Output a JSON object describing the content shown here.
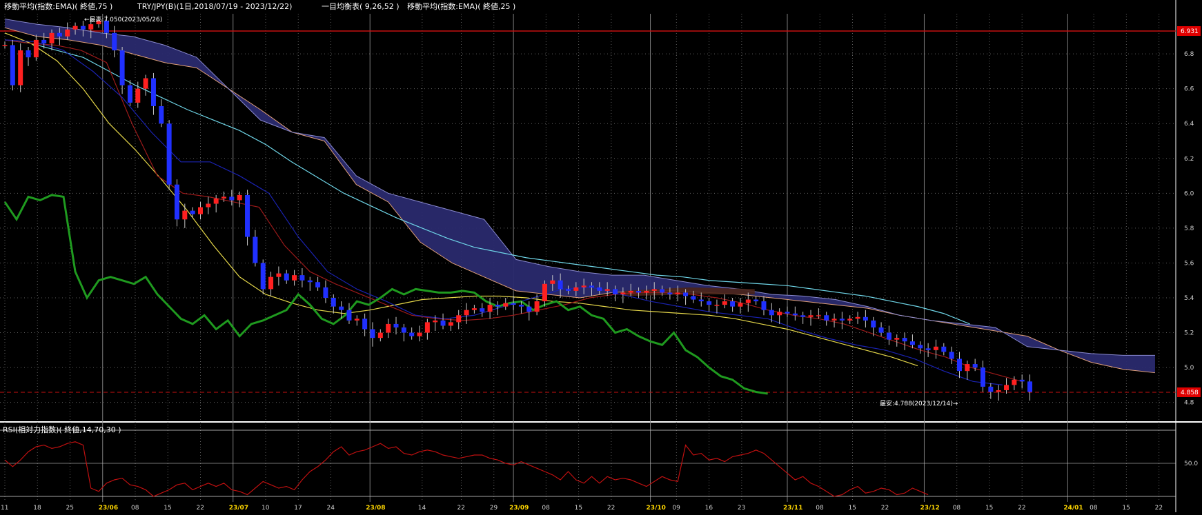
{
  "header": {
    "ema75_label": "移動平均(指数:EMA)( 終値,75 )",
    "symbol_label": "TRY/JPY(B)(1日,2018/07/19 - 2023/12/22)",
    "ichimoku_label": "一目均衡表( 9,26,52 )",
    "ema25_label": "移動平均(指数:EMA)( 終値,25 )"
  },
  "rsi_panel": {
    "title": "RSI(相対力指数)( 終値,14,70,30 )"
  },
  "annotations": {
    "high_label": "←最高:7.050(2023/05/26)",
    "low_label": "最安:4.788(2023/12/14)→"
  },
  "price_boxes": {
    "top_value": "6.931",
    "current_value": "4.858"
  },
  "colors": {
    "background": "#000000",
    "grid": "#ffffff",
    "candle_up": "#ff2020",
    "candle_down": "#2030ff",
    "cloud_fill": "#2a2a6e",
    "cloud_bear_fill": "#4a2418",
    "ema75": "#6fd6e8",
    "ema25": "#e6d84a",
    "kijun": "#9c1a1a",
    "tenkan": "#1a22b0",
    "chikou": "#1f9a1f",
    "span_b_line": "#e0a078",
    "span_a_line": "#8a8ad0",
    "rsi_line": "#c01010",
    "ref_line": "#c81010"
  },
  "chart_data": {
    "type": "candlestick",
    "symbol": "TRY/JPY",
    "ylim": [
      4.72,
      7.1
    ],
    "y_ticks": [
      "6.8",
      "6.6",
      "6.4",
      "6.2",
      "6.0",
      "5.8",
      "5.6",
      "5.4",
      "5.2",
      "5.0",
      "4.8"
    ],
    "x_ticks": [
      {
        "label": "11",
        "day": 0,
        "month": false
      },
      {
        "label": "18",
        "day": 5,
        "month": false
      },
      {
        "label": "25",
        "day": 10,
        "month": false
      },
      {
        "label": "23/06",
        "day": 15,
        "month": true
      },
      {
        "label": "08",
        "day": 20,
        "month": false
      },
      {
        "label": "15",
        "day": 25,
        "month": false
      },
      {
        "label": "22",
        "day": 30,
        "month": false
      },
      {
        "label": "23/07",
        "day": 35,
        "month": true
      },
      {
        "label": "10",
        "day": 40,
        "month": false
      },
      {
        "label": "17",
        "day": 45,
        "month": false
      },
      {
        "label": "24",
        "day": 50,
        "month": false
      },
      {
        "label": "23/08",
        "day": 56,
        "month": true
      },
      {
        "label": "14",
        "day": 64,
        "month": false
      },
      {
        "label": "22",
        "day": 70,
        "month": false
      },
      {
        "label": "29",
        "day": 75,
        "month": false
      },
      {
        "label": "23/09",
        "day": 78,
        "month": true
      },
      {
        "label": "08",
        "day": 83,
        "month": false
      },
      {
        "label": "15",
        "day": 88,
        "month": false
      },
      {
        "label": "22",
        "day": 93,
        "month": false
      },
      {
        "label": "23/10",
        "day": 99,
        "month": true
      },
      {
        "label": "09",
        "day": 103,
        "month": false
      },
      {
        "label": "16",
        "day": 108,
        "month": false
      },
      {
        "label": "23",
        "day": 113,
        "month": false
      },
      {
        "label": "23/11",
        "day": 120,
        "month": true
      },
      {
        "label": "08",
        "day": 125,
        "month": false
      },
      {
        "label": "15",
        "day": 130,
        "month": false
      },
      {
        "label": "22",
        "day": 135,
        "month": false
      },
      {
        "label": "23/12",
        "day": 141,
        "month": true
      },
      {
        "label": "08",
        "day": 146,
        "month": false
      },
      {
        "label": "15",
        "day": 151,
        "month": false
      },
      {
        "label": "22",
        "day": 156,
        "month": false
      },
      {
        "label": "24/01",
        "day": 163,
        "month": true
      },
      {
        "label": "08",
        "day": 167,
        "month": false
      },
      {
        "label": "15",
        "day": 172,
        "month": false
      },
      {
        "label": "22",
        "day": 177,
        "month": false
      }
    ],
    "ohlc_closes": [
      6.85,
      6.62,
      6.82,
      6.78,
      6.88,
      6.86,
      6.92,
      6.9,
      6.94,
      6.96,
      6.94,
      6.97,
      6.99,
      6.92,
      6.82,
      6.62,
      6.52,
      6.6,
      6.66,
      6.5,
      6.4,
      6.05,
      5.85,
      5.9,
      5.88,
      5.92,
      5.94,
      5.97,
      5.98,
      5.96,
      5.99,
      5.75,
      5.6,
      5.45,
      5.52,
      5.54,
      5.5,
      5.53,
      5.5,
      5.49,
      5.46,
      5.4,
      5.35,
      5.33,
      5.27,
      5.28,
      5.22,
      5.17,
      5.2,
      5.25,
      5.23,
      5.2,
      5.18,
      5.2,
      5.26,
      5.27,
      5.24,
      5.26,
      5.3,
      5.33,
      5.34,
      5.32,
      5.36,
      5.35,
      5.37,
      5.36,
      5.35,
      5.32,
      5.38,
      5.48,
      5.5,
      5.45,
      5.44,
      5.46,
      5.47,
      5.46,
      5.44,
      5.45,
      5.42,
      5.43,
      5.44,
      5.43,
      5.44,
      5.45,
      5.43,
      5.42,
      5.43,
      5.41,
      5.39,
      5.38,
      5.36,
      5.36,
      5.38,
      5.35,
      5.37,
      5.39,
      5.38,
      5.33,
      5.3,
      5.32,
      5.31,
      5.3,
      5.29,
      5.3,
      5.3,
      5.27,
      5.28,
      5.27,
      5.28,
      5.29,
      5.27,
      5.23,
      5.2,
      5.16,
      5.17,
      5.15,
      5.13,
      5.11,
      5.1,
      5.12,
      5.09,
      5.05,
      4.98,
      5.02,
      5.0,
      4.89,
      4.86,
      4.87,
      4.9,
      4.93,
      4.92,
      4.86
    ],
    "high": 7.05,
    "high_date": "2023/05/26",
    "low": 4.788,
    "low_date": "2023/12/14",
    "last_price": 4.858,
    "top_ref_price": 6.931,
    "series": [
      {
        "name": "EMA75",
        "values": [
          6.88,
          6.86,
          6.82,
          6.78,
          6.7,
          6.62,
          6.55,
          6.48,
          6.42,
          6.36,
          6.28,
          6.18,
          6.09,
          6.0,
          5.93,
          5.86,
          5.8,
          5.74,
          5.69,
          5.66,
          5.63,
          5.61,
          5.59,
          5.57,
          5.55,
          5.53,
          5.52,
          5.5,
          5.49,
          5.48,
          5.47,
          5.45,
          5.43,
          5.41,
          5.38,
          5.35,
          5.31,
          5.25
        ]
      },
      {
        "name": "EMA25",
        "values": [
          6.92,
          6.86,
          6.76,
          6.6,
          6.4,
          6.25,
          6.08,
          5.9,
          5.7,
          5.52,
          5.42,
          5.37,
          5.33,
          5.31,
          5.33,
          5.36,
          5.39,
          5.4,
          5.41,
          5.41,
          5.4,
          5.38,
          5.37,
          5.35,
          5.33,
          5.32,
          5.31,
          5.3,
          5.28,
          5.25,
          5.22,
          5.18,
          5.14,
          5.1,
          5.06,
          5.01
        ]
      },
      {
        "name": "RSI",
        "values": [
          52,
          48,
          52,
          57,
          60,
          61,
          59,
          60,
          62,
          63,
          61,
          35,
          33,
          38,
          40,
          41,
          37,
          36,
          34,
          30,
          32,
          34,
          37,
          38,
          34,
          36,
          38,
          36,
          38,
          34,
          33,
          31,
          35,
          39,
          37,
          35,
          36,
          34,
          40,
          45,
          48,
          52,
          57,
          60,
          55,
          57,
          58,
          60,
          62,
          59,
          60,
          56,
          55,
          57,
          58,
          57,
          55,
          54,
          53,
          54,
          55,
          55,
          53,
          52,
          50,
          49,
          51,
          49,
          47,
          45,
          43,
          40,
          45,
          40,
          38,
          42,
          38,
          42,
          40,
          41,
          40,
          38,
          36,
          39,
          42,
          40,
          39,
          61,
          55,
          56,
          52,
          53,
          51,
          54,
          55,
          56,
          58,
          56,
          52,
          48,
          44,
          40,
          42,
          38,
          36,
          33,
          30,
          31,
          34,
          36,
          32,
          33,
          35,
          34,
          31,
          32,
          35,
          33,
          31
        ]
      }
    ]
  }
}
